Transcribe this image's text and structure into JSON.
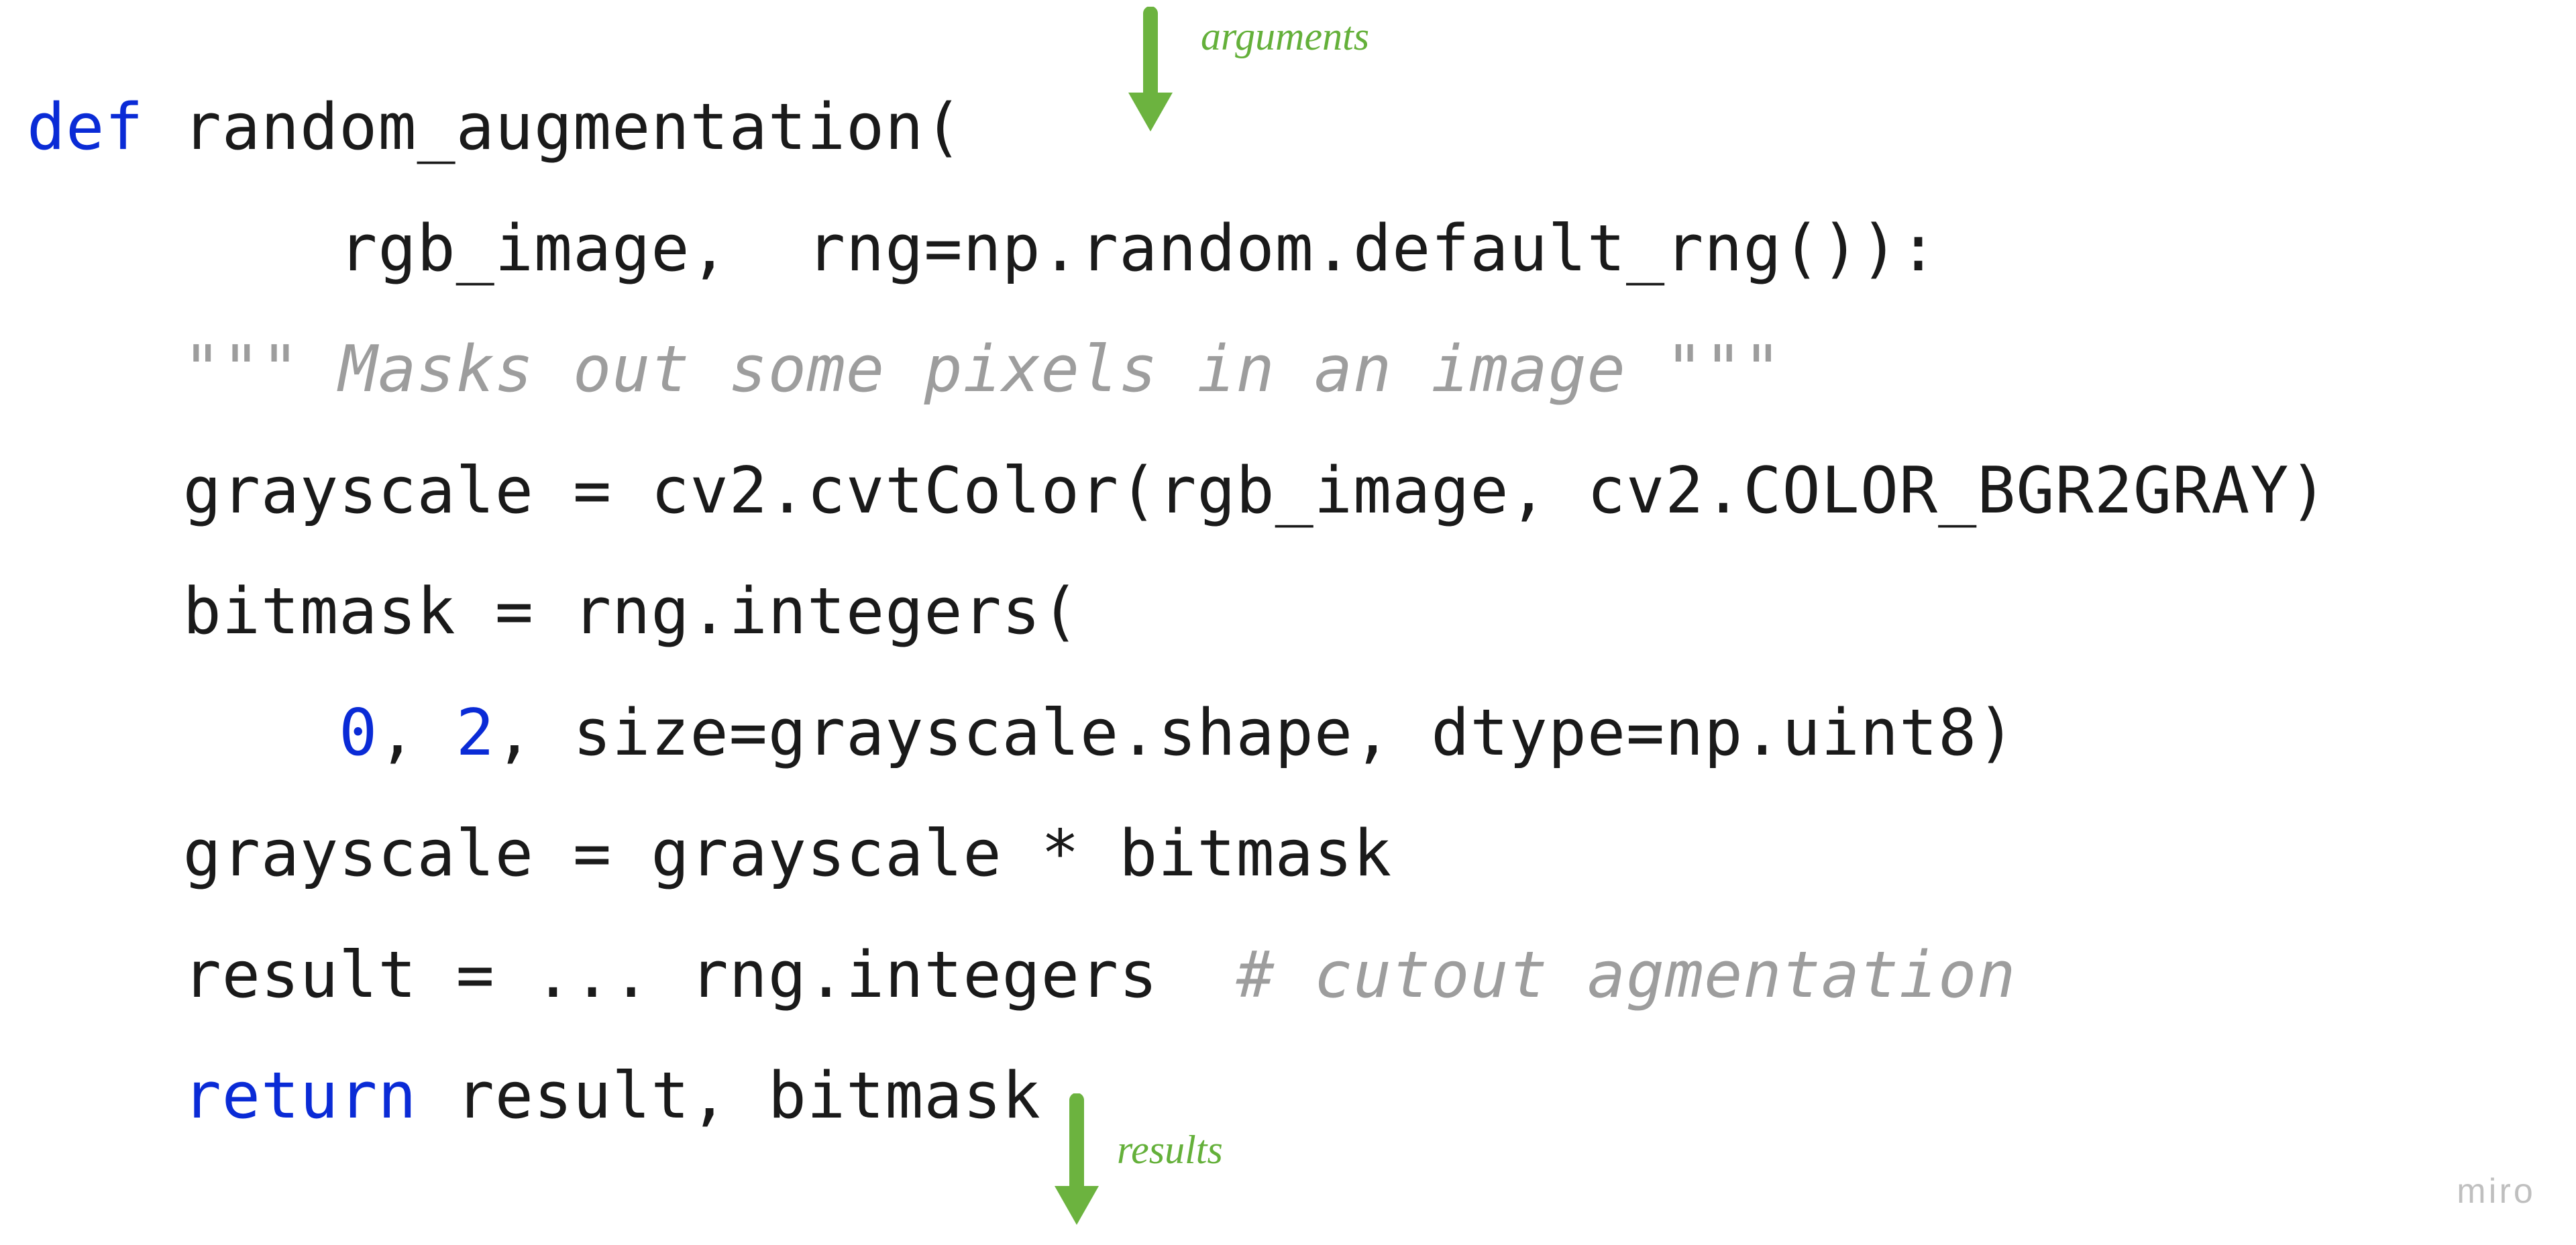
{
  "annotations": {
    "top_label": "arguments",
    "bottom_label": "results"
  },
  "code": {
    "lines": [
      {
        "indent": "",
        "spans": [
          {
            "t": "def ",
            "cls": "kw"
          },
          {
            "t": "random_augmentation(",
            "cls": ""
          }
        ]
      },
      {
        "indent": "        ",
        "spans": [
          {
            "t": "rgb_image,  rng=np.random.default_rng()):",
            "cls": ""
          }
        ]
      },
      {
        "indent": "    ",
        "spans": [
          {
            "t": "\"\"\" Masks out some pixels in an image \"\"\"",
            "cls": "docstr"
          }
        ]
      },
      {
        "indent": "    ",
        "spans": [
          {
            "t": "grayscale = cv2.cvtColor(rgb_image, cv2.COLOR_BGR2GRAY)",
            "cls": ""
          }
        ]
      },
      {
        "indent": "    ",
        "spans": [
          {
            "t": "bitmask = rng.integers(",
            "cls": ""
          }
        ]
      },
      {
        "indent": "        ",
        "spans": [
          {
            "t": "0",
            "cls": "num"
          },
          {
            "t": ", ",
            "cls": ""
          },
          {
            "t": "2",
            "cls": "num"
          },
          {
            "t": ", size=grayscale.shape, dtype=np.uint8)",
            "cls": ""
          }
        ]
      },
      {
        "indent": "    ",
        "spans": [
          {
            "t": "grayscale = grayscale * bitmask",
            "cls": ""
          }
        ]
      },
      {
        "indent": "    ",
        "spans": [
          {
            "t": "result = ... rng.integers  ",
            "cls": ""
          },
          {
            "t": "# cutout agmentation",
            "cls": "comment"
          }
        ]
      },
      {
        "indent": "    ",
        "spans": [
          {
            "t": "return ",
            "cls": "kw"
          },
          {
            "t": "result, bitmask",
            "cls": ""
          }
        ]
      }
    ]
  },
  "watermark": "miro",
  "colors": {
    "keyword": "#0a2bd6",
    "number": "#0a2bd6",
    "comment": "#9d9d9d",
    "annotation": "#64b03a",
    "arrow": "#6cb33f"
  }
}
